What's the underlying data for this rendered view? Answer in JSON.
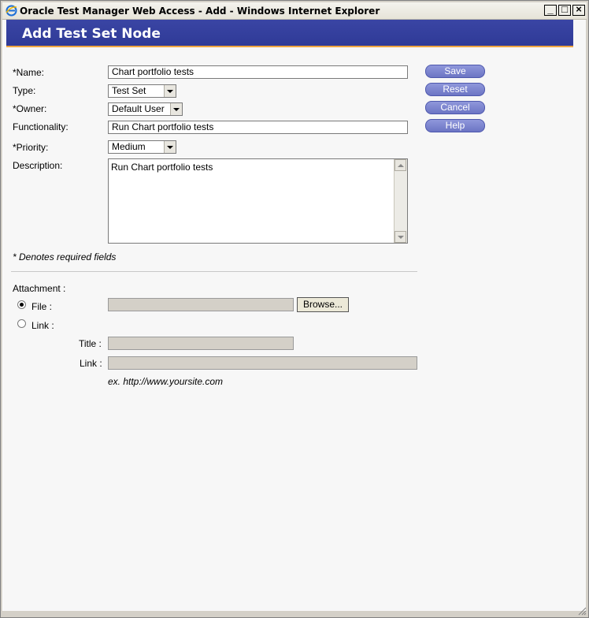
{
  "window": {
    "title": "Oracle Test Manager Web Access - Add - Windows Internet Explorer",
    "btn_min": "_",
    "btn_max": "□",
    "btn_close": "×"
  },
  "header": {
    "title": "Add Test Set Node"
  },
  "form": {
    "name_label": "*Name:",
    "name_value": "Chart portfolio tests",
    "type_label": "Type:",
    "type_value": "Test Set",
    "owner_label": "*Owner:",
    "owner_value": "Default User",
    "functionality_label": "Functionality:",
    "functionality_value": "Run Chart portfolio tests",
    "priority_label": "*Priority:",
    "priority_value": "Medium",
    "description_label": "Description:",
    "description_value": "Run Chart portfolio tests",
    "required_note": "* Denotes required fields"
  },
  "actions": {
    "save": "Save",
    "reset": "Reset",
    "cancel": "Cancel",
    "help": "Help"
  },
  "attachment": {
    "label": "Attachment :",
    "file_label": "File :",
    "file_selected": true,
    "browse": "Browse...",
    "link_radio_label": "Link :",
    "title_label": "Title :",
    "title_value": "",
    "link_label": "Link :",
    "link_value": "",
    "example": "ex. http://www.yoursite.com"
  },
  "colors": {
    "header": "#2f3a97",
    "accent": "#f0a640",
    "button": "#7a82cf"
  }
}
